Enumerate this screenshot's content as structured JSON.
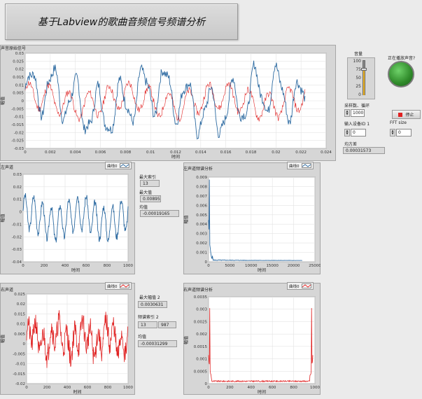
{
  "title": "基于Labview的歌曲音频信号频谱分析",
  "colors": {
    "blue": "#2c6aa1",
    "red": "#e02121",
    "led_green": "#2f8a2a"
  },
  "main_plot": {
    "label": "声音原始信号",
    "ylabel": "幅值",
    "xlabel": "时间",
    "yticks": [
      "0.03",
      "0.025",
      "0.02",
      "0.015",
      "0.01",
      "0.005",
      "0",
      "-0.005",
      "-0.01",
      "-0.015",
      "-0.02",
      "-0.025",
      "-0.03"
    ],
    "xticks": [
      "0",
      "0.002",
      "0.004",
      "0.006",
      "0.008",
      "0.01",
      "0.012",
      "0.014",
      "0.016",
      "0.018",
      "0.02",
      "0.022",
      "0.024"
    ]
  },
  "volume": {
    "label": "音量",
    "ticks": [
      "100",
      "75",
      "50",
      "25",
      "0"
    ],
    "value": 75
  },
  "playing": {
    "label": "正在播放声音?"
  },
  "sample_count": {
    "label": "采样数、循环",
    "value": "1000"
  },
  "stop_button": {
    "label": "停止"
  },
  "device_id": {
    "label": "输入设备ID 1",
    "value": "0"
  },
  "fft_size": {
    "label": "FFT size",
    "value": "0"
  },
  "variance": {
    "label": "均方差",
    "value": "0.00031573"
  },
  "left_channel": {
    "label": "左声道",
    "legend": "曲线0",
    "ylabel": "幅值",
    "xlabel": "时间",
    "yticks": [
      "0.03",
      "0.02",
      "0.01",
      "0",
      "-0.01",
      "-0.02",
      "-0.03",
      "-0.04"
    ],
    "xticks": [
      "0",
      "200",
      "400",
      "600",
      "800",
      "1000"
    ]
  },
  "left_stats": {
    "max_index_label": "最大索引",
    "max_index_value": "13",
    "max_value_label": "最大值",
    "max_value_value": "0.00895",
    "mean_label": "均值",
    "mean_value": "-0.00019165"
  },
  "left_spectrum": {
    "label": "左声道频谱分析",
    "legend": "曲线0",
    "ylabel": "幅值",
    "xlabel": "时间",
    "yticks": [
      "0.009",
      "0.008",
      "0.007",
      "0.006",
      "0.005",
      "0.004",
      "0.003",
      "0.002",
      "0.001",
      "0"
    ],
    "xticks": [
      "0",
      "5000",
      "10000",
      "15000",
      "20000",
      "25000"
    ]
  },
  "right_channel": {
    "label": "右声道",
    "legend": "曲线0",
    "ylabel": "幅值",
    "xlabel": "时间",
    "yticks": [
      "0.025",
      "0.02",
      "0.015",
      "0.01",
      "0.005",
      "0",
      "-0.005",
      "-0.01",
      "-0.015",
      "-0.02"
    ],
    "xticks": [
      "0",
      "200",
      "400",
      "600",
      "800",
      "1000"
    ]
  },
  "right_stats": {
    "max_amp_label": "最大幅值 2",
    "max_amp_value": "0.0030631",
    "freq_index_label": "频谱索引 2",
    "freq_index_a": "13",
    "freq_index_b": "987",
    "mean_label": "均值",
    "mean_value": "-0.00031299"
  },
  "right_spectrum": {
    "label": "右声道频谱分析",
    "legend": "曲线0",
    "ylabel": "幅值",
    "xlabel": "时间",
    "yticks": [
      "0.0035",
      "0.003",
      "0.0025",
      "0.002",
      "0.0015",
      "0.001",
      "0.0005",
      "0"
    ],
    "xticks": [
      "0",
      "200",
      "400",
      "600",
      "800",
      "1000"
    ]
  }
}
